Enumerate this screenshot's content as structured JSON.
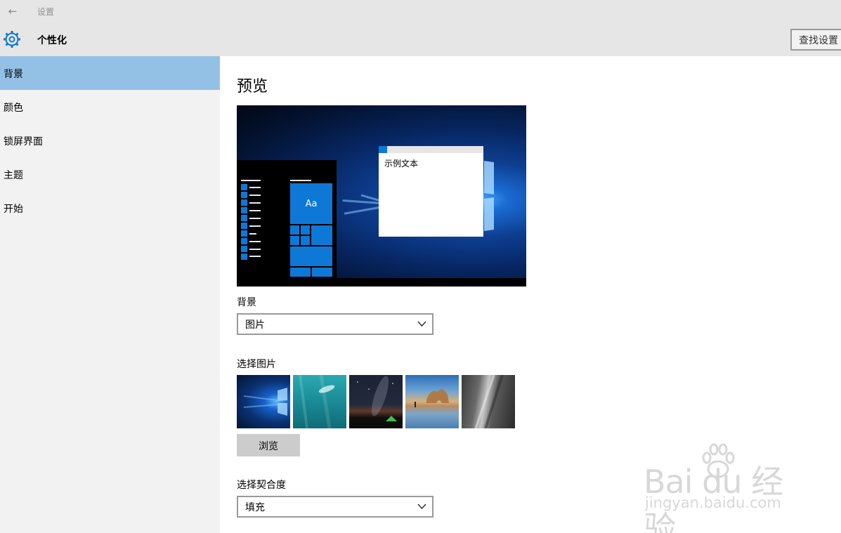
{
  "window": {
    "title": "设置",
    "back_icon": "back-arrow-icon"
  },
  "header": {
    "title": "个性化",
    "search_label": "查找设置",
    "icon": "gear-icon"
  },
  "sidebar": {
    "items": [
      {
        "label": "背景",
        "active": true
      },
      {
        "label": "颜色",
        "active": false
      },
      {
        "label": "锁屏界面",
        "active": false
      },
      {
        "label": "主题",
        "active": false
      },
      {
        "label": "开始",
        "active": false
      }
    ]
  },
  "main": {
    "section_title": "预览",
    "preview": {
      "sample_text": "示例文本",
      "tile_label": "Aa"
    },
    "background": {
      "label": "背景",
      "value": "图片"
    },
    "choose_picture": {
      "label": "选择图片",
      "browse_label": "浏览"
    },
    "fit": {
      "label": "选择契合度",
      "value": "填充"
    }
  },
  "watermark": {
    "brand": "Bai du 经验",
    "url": "jingyan.baidu.com"
  },
  "colors": {
    "accent": "#0e78d6",
    "selected_nav": "#93c1e6",
    "sidebar_bg": "#f2f2f2",
    "titlebar_bg": "#e6e6e6"
  }
}
